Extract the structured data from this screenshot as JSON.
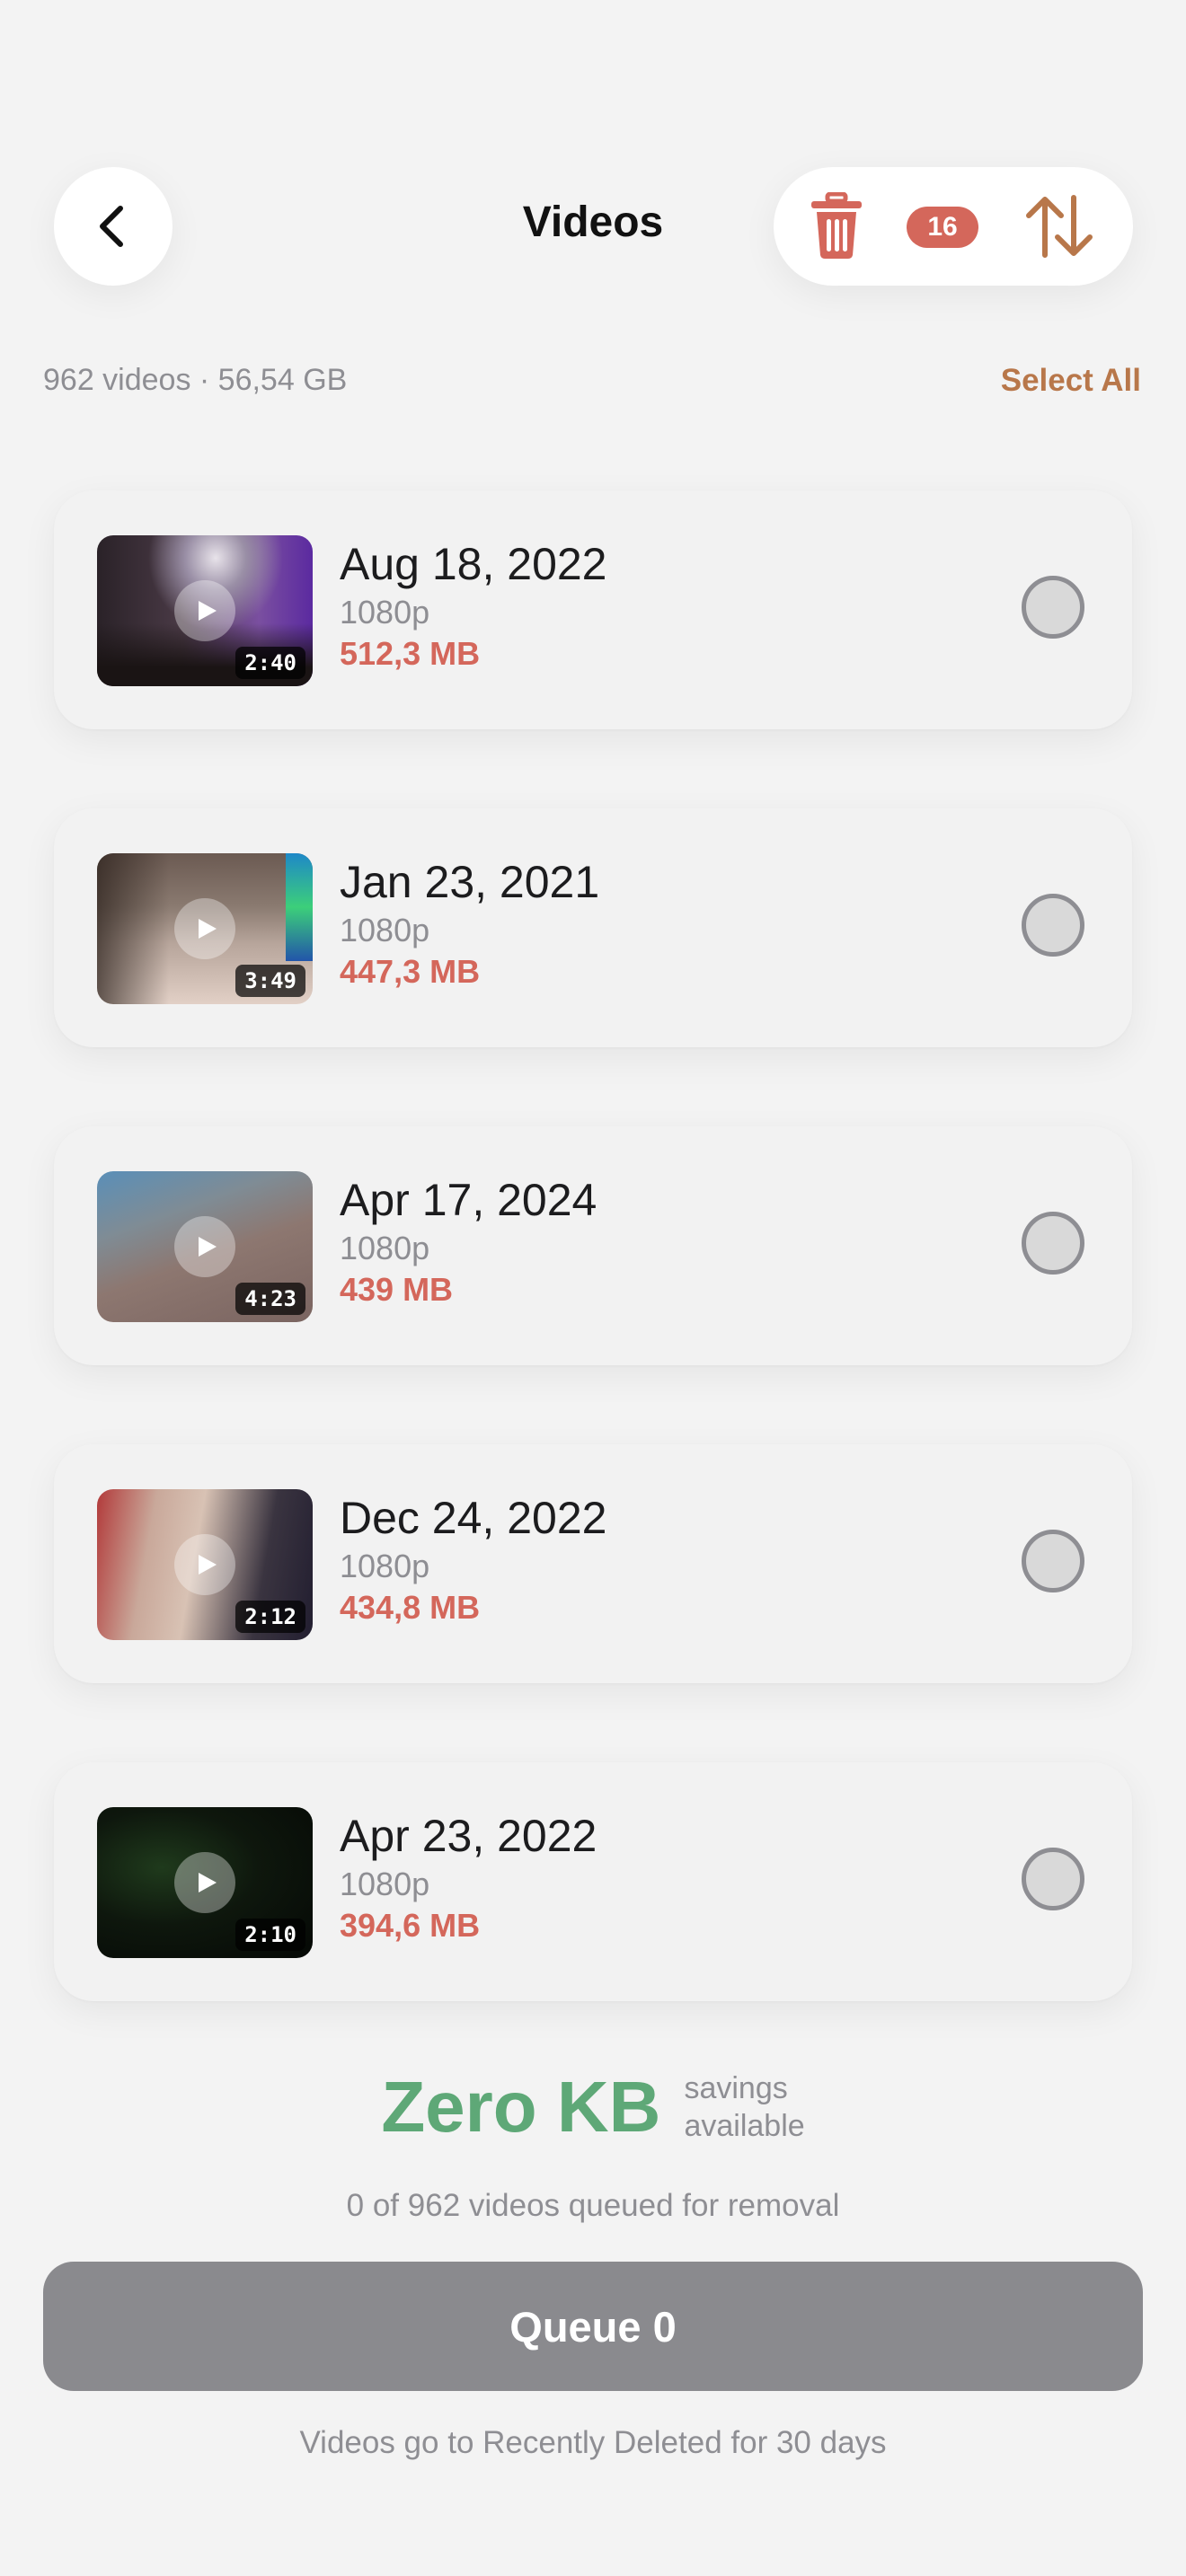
{
  "header": {
    "title": "Videos",
    "trash_count": "16"
  },
  "summary": {
    "text": "962 videos · 56,54 GB",
    "select_all_label": "Select All"
  },
  "videos": [
    {
      "date": "Aug 18, 2022",
      "resolution": "1080p",
      "size": "512,3 MB",
      "duration": "2:40",
      "selected": false
    },
    {
      "date": "Jan 23, 2021",
      "resolution": "1080p",
      "size": "447,3 MB",
      "duration": "3:49",
      "selected": false
    },
    {
      "date": "Apr 17, 2024",
      "resolution": "1080p",
      "size": "439 MB",
      "duration": "4:23",
      "selected": false
    },
    {
      "date": "Dec 24, 2022",
      "resolution": "1080p",
      "size": "434,8 MB",
      "duration": "2:12",
      "selected": false
    },
    {
      "date": "Apr 23, 2022",
      "resolution": "1080p",
      "size": "394,6 MB",
      "duration": "2:10",
      "selected": false
    }
  ],
  "footer": {
    "savings_value": "Zero KB",
    "savings_label_line1": "savings",
    "savings_label_line2": "available",
    "queued_text": "0 of 962 videos queued for removal",
    "queue_button_label": "Queue 0",
    "footnote": "Videos go to Recently Deleted for 30 days"
  },
  "colors": {
    "accent_orange": "#b8774a",
    "size_red": "#d4675b",
    "savings_green": "#5ea877",
    "button_gray": "#8a8a8e"
  }
}
